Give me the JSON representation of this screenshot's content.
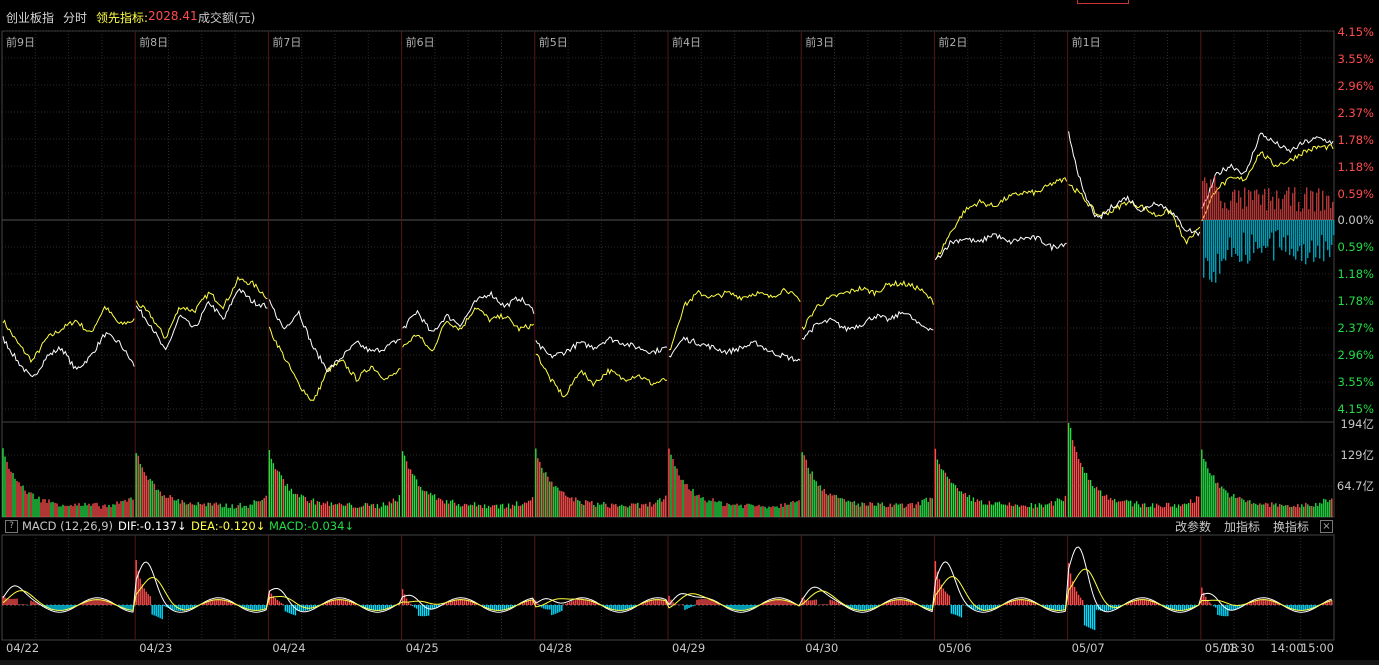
{
  "header": {
    "index_name": "创业板指",
    "mode": "分时",
    "leading_label": "领先指标:",
    "leading_value": "2028.41",
    "volume_label": "成交额(元)"
  },
  "day_labels": [
    "前9日",
    "前8日",
    "前7日",
    "前6日",
    "前5日",
    "前4日",
    "前3日",
    "前2日",
    "前1日"
  ],
  "pct_axis": {
    "up_labels": [
      "4.15%",
      "3.55%",
      "2.96%",
      "2.37%",
      "1.78%",
      "1.18%",
      "0.59%"
    ],
    "zero_label": "0.00%",
    "down_labels": [
      "0.59%",
      "1.18%",
      "1.78%",
      "2.37%",
      "2.96%",
      "3.55%",
      "4.15%"
    ]
  },
  "volume_axis": {
    "labels": [
      "194亿",
      "129亿",
      "64.7亿"
    ]
  },
  "macd_bar": {
    "help": "?",
    "name": "MACD (12,26,9)",
    "dif": "DIF:-0.137↓",
    "dea": "DEA:-0.120↓",
    "macd": "MACD:-0.034↓",
    "tools": [
      "改参数",
      "加指标",
      "换指标"
    ],
    "close": "×"
  },
  "x_axis": {
    "dates": [
      "04/22",
      "04/23",
      "04/24",
      "04/25",
      "04/28",
      "04/29",
      "04/30",
      "05/06",
      "05/07",
      "05/08"
    ],
    "times": [
      "11:30",
      "14:00",
      "15:00"
    ]
  },
  "colors": {
    "up": "#ff4d4d",
    "down": "#22dd44",
    "price_line": "#ffffff",
    "leading_line": "#ffff44",
    "macd_pos": "#ff4d4d",
    "macd_neg": "#00ddff",
    "grid": "#2a2a2a",
    "grid_major": "#4a0e0e"
  },
  "chart_data": {
    "type": "line",
    "title": "创业板指",
    "price_change_pct": {
      "range": [
        -4.15,
        4.15
      ],
      "days": [
        {
          "label": "前9日",
          "white": [
            -2.6,
            -3.1,
            -3.5,
            -3.0,
            -2.8,
            -3.3,
            -3.0,
            -2.5,
            -2.7,
            -3.2
          ],
          "yellow": [
            -2.2,
            -2.7,
            -3.1,
            -2.6,
            -2.4,
            -2.2,
            -2.5,
            -1.9,
            -2.3,
            -2.2
          ]
        },
        {
          "label": "前8日",
          "white": [
            -1.9,
            -2.3,
            -2.9,
            -2.1,
            -2.4,
            -1.8,
            -2.2,
            -1.5,
            -1.8,
            -1.9
          ],
          "yellow": [
            -1.8,
            -2.1,
            -2.6,
            -1.9,
            -2.0,
            -1.6,
            -1.9,
            -1.3,
            -1.4,
            -1.7
          ]
        },
        {
          "label": "前7日",
          "white": [
            -1.8,
            -2.4,
            -2.0,
            -2.8,
            -3.3,
            -3.0,
            -2.7,
            -2.9,
            -2.8,
            -2.6
          ],
          "yellow": [
            -2.4,
            -3.0,
            -3.6,
            -4.0,
            -3.3,
            -3.1,
            -3.5,
            -3.2,
            -3.5,
            -3.3
          ]
        },
        {
          "label": "前6日",
          "white": [
            -2.4,
            -2.0,
            -2.5,
            -2.1,
            -2.3,
            -1.8,
            -1.6,
            -1.9,
            -1.7,
            -2.0
          ],
          "yellow": [
            -2.8,
            -2.5,
            -2.9,
            -2.2,
            -2.4,
            -1.9,
            -2.2,
            -2.1,
            -2.4,
            -2.3
          ]
        },
        {
          "label": "前5日",
          "white": [
            -2.7,
            -3.0,
            -2.9,
            -2.7,
            -2.8,
            -2.6,
            -2.7,
            -2.8,
            -2.9,
            -2.8
          ],
          "yellow": [
            -2.9,
            -3.5,
            -3.9,
            -3.3,
            -3.6,
            -3.3,
            -3.5,
            -3.4,
            -3.6,
            -3.5
          ]
        },
        {
          "label": "前4日",
          "white": [
            -3.0,
            -2.6,
            -2.7,
            -2.8,
            -2.9,
            -2.8,
            -2.7,
            -2.9,
            -3.0,
            -3.1
          ],
          "yellow": [
            -2.9,
            -1.9,
            -1.6,
            -1.7,
            -1.6,
            -1.7,
            -1.6,
            -1.7,
            -1.5,
            -1.8
          ]
        },
        {
          "label": "前3日",
          "white": [
            -2.6,
            -2.3,
            -2.2,
            -2.4,
            -2.3,
            -2.1,
            -2.2,
            -2.0,
            -2.3,
            -2.4
          ],
          "yellow": [
            -2.4,
            -1.9,
            -1.7,
            -1.6,
            -1.5,
            -1.6,
            -1.4,
            -1.4,
            -1.5,
            -1.8
          ]
        },
        {
          "label": "前2日",
          "white": [
            -0.9,
            -0.5,
            -0.4,
            -0.5,
            -0.3,
            -0.5,
            -0.4,
            -0.4,
            -0.6,
            -0.5
          ],
          "yellow": [
            -0.9,
            -0.3,
            0.2,
            0.4,
            0.3,
            0.5,
            0.6,
            0.6,
            0.8,
            0.9
          ]
        },
        {
          "label": "前1日",
          "white": [
            1.9,
            0.6,
            0.0,
            0.3,
            0.5,
            0.2,
            0.4,
            0.2,
            -0.2,
            -0.3
          ],
          "yellow": [
            0.8,
            0.5,
            0.1,
            0.2,
            0.4,
            0.3,
            0.1,
            0.2,
            -0.5,
            -0.2
          ]
        },
        {
          "label": "05/08",
          "white": [
            0.2,
            1.0,
            1.2,
            1.0,
            1.9,
            1.7,
            1.5,
            1.7,
            1.8,
            1.7
          ],
          "yellow": [
            0.0,
            0.7,
            0.9,
            0.9,
            1.5,
            1.2,
            1.3,
            1.5,
            1.6,
            1.6
          ]
        }
      ]
    },
    "volume_axis_max": "194亿",
    "macd": {
      "dif": -0.137,
      "dea": -0.12,
      "macd": -0.034
    }
  }
}
